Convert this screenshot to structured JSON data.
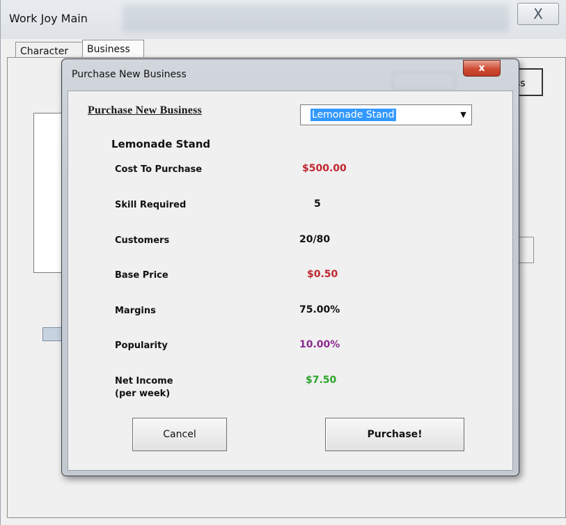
{
  "main_window": {
    "title": "Work Joy Main",
    "close_glyph": "X",
    "tabs": [
      {
        "label": "Character"
      },
      {
        "label": "Business"
      }
    ],
    "partial_button_text": "ss"
  },
  "dialog": {
    "title": "Purchase New Business",
    "close_glyph": "x",
    "heading": "Purchase New Business",
    "business_select": {
      "value": "Lemonade Stand"
    },
    "business_name": "Lemonade Stand",
    "stats": {
      "cost": {
        "label": "Cost To Purchase",
        "value": "$500.00",
        "color": "#c0272d"
      },
      "skill": {
        "label": "Skill Required",
        "value": "5",
        "color": "#111111"
      },
      "customers": {
        "label": "Customers",
        "value": "20/80",
        "color": "#111111"
      },
      "base_price": {
        "label": "Base Price",
        "value": "$0.50",
        "color": "#c0272d"
      },
      "margins": {
        "label": "Margins",
        "value": "75.00%",
        "color": "#111111"
      },
      "popularity": {
        "label": "Popularity",
        "value": "10.00%",
        "color": "#8b2a8f"
      },
      "net_income": {
        "label": "Net Income",
        "label2": "(per week)",
        "value": "$7.50",
        "color": "#2aa52a"
      }
    },
    "buttons": {
      "cancel": "Cancel",
      "purchase": "Purchase!"
    }
  }
}
